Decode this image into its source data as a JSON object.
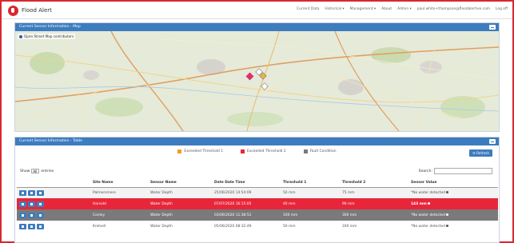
{
  "app": {
    "name": "Flood Alert"
  },
  "nav": {
    "items": [
      "Current Data",
      "Historical ▾",
      "Management ▾",
      "About",
      "Admin ▾",
      "paul.white+thompson@floodalertive.com",
      "Log off"
    ]
  },
  "map_panel": {
    "title": "Current Sensor Information - Map",
    "attribution": "Open Street Map contributors"
  },
  "table_panel": {
    "title": "Current Sensor Information - Table",
    "legend": [
      {
        "label": "Exceeded Threshold 1",
        "color": "#f0a020"
      },
      {
        "label": "Exceeded Threshold 2",
        "color": "#e8263a"
      },
      {
        "label": "Fault Condition",
        "color": "#7a7a7a"
      }
    ],
    "refresh_label": "Refresh",
    "show_prefix": "Show",
    "show_value": "All",
    "show_suffix": "entries",
    "search_label": "Search:",
    "columns": [
      "",
      "Site Name",
      "Sensor Name",
      "Date Date Time",
      "Threshold 1",
      "Threshold 2",
      "Sensor Value"
    ],
    "rows": [
      {
        "status": "normal",
        "site": "Palmersmere",
        "sensor": "Water Depth",
        "datetime": "25/06/2020 14:54:09",
        "t1": "50 mm",
        "t2": "75 mm",
        "value": "*No water detected"
      },
      {
        "status": "red",
        "site": "Harsold",
        "sensor": "Water Depth",
        "datetime": "07/07/2020 16:15:05",
        "t1": "40 mm",
        "t2": "90 mm",
        "value": "143 mm"
      },
      {
        "status": "gray",
        "site": "Conley",
        "sensor": "Water Depth",
        "datetime": "03/06/2020 11:38:51",
        "t1": "100 mm",
        "t2": "300 mm",
        "value": "*No water detected"
      },
      {
        "status": "normal",
        "site": "Kretsell",
        "sensor": "Water Depth",
        "datetime": "05/06/2020 08:32:49",
        "t1": "50 mm",
        "t2": "160 mm",
        "value": "*No water detected"
      }
    ]
  },
  "colors": {
    "accent": "#3d7cbf",
    "brand": "#d9282f"
  }
}
